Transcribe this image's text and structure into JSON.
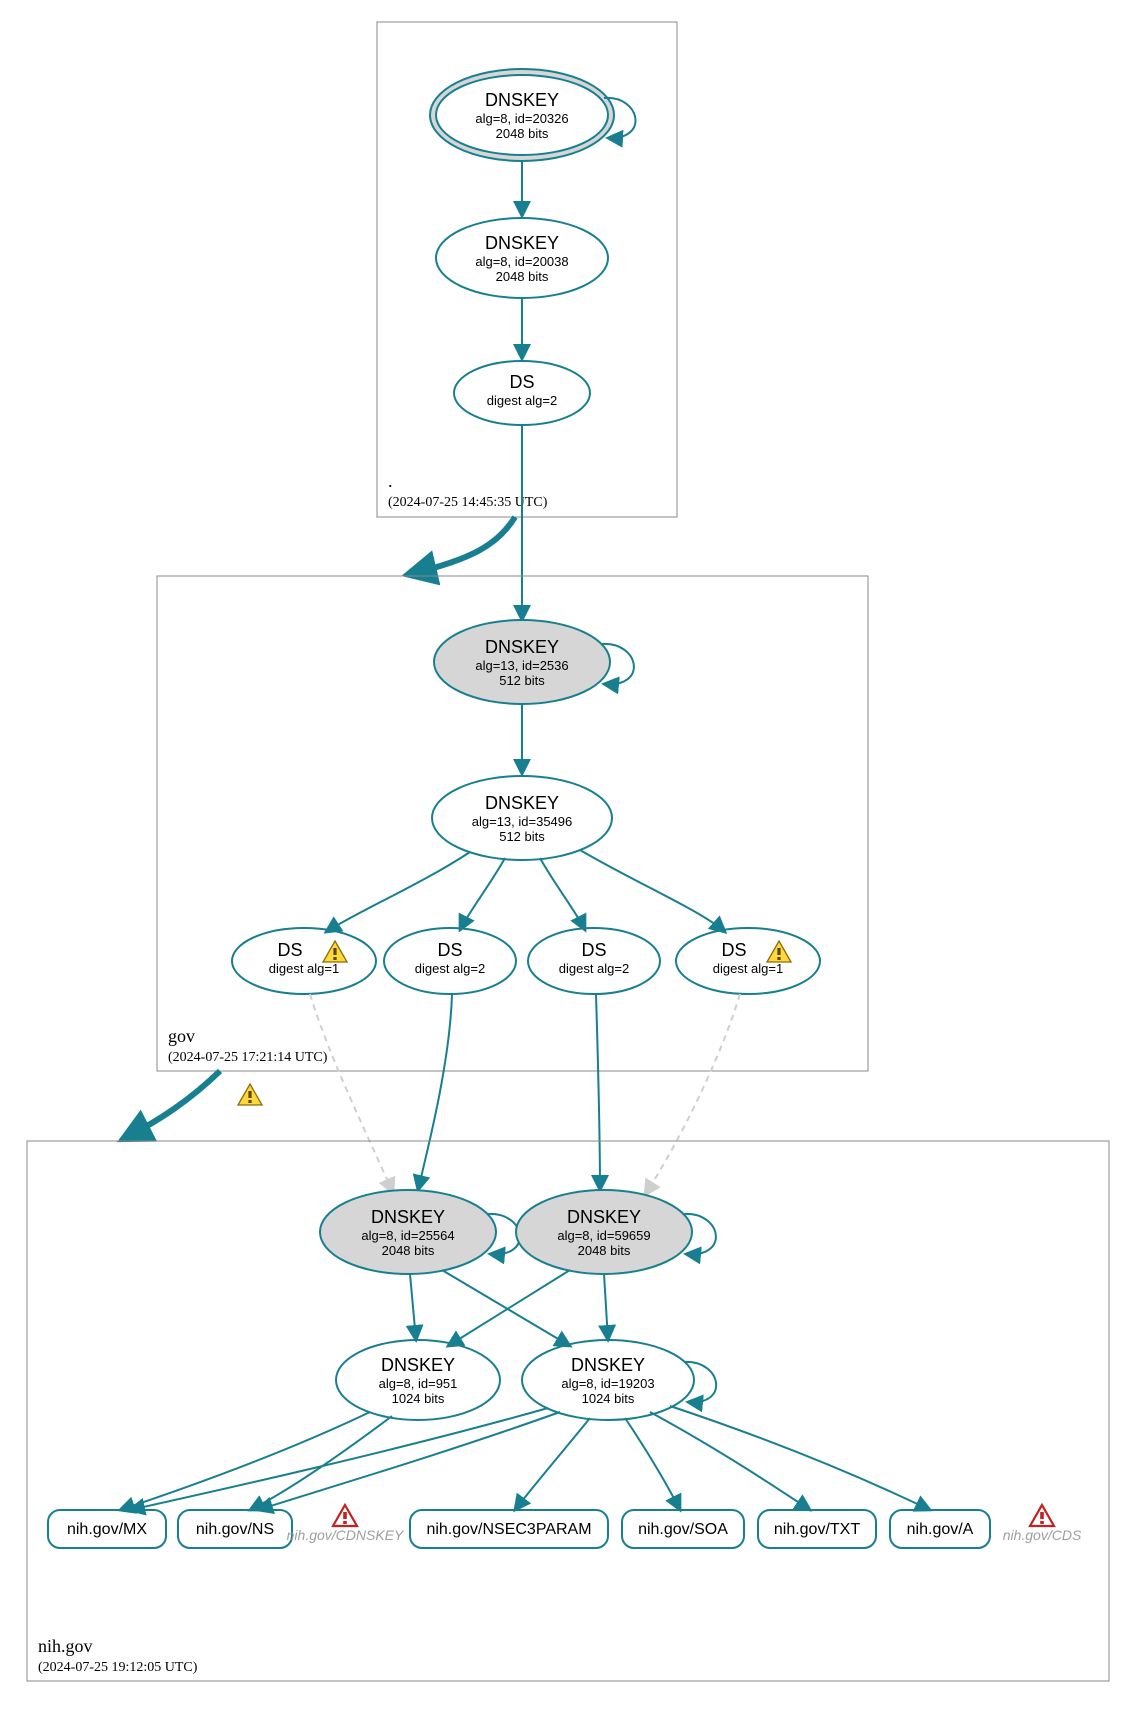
{
  "zones": {
    "root": {
      "name": ".",
      "timestamp": "(2024-07-25 14:45:35 UTC)"
    },
    "gov": {
      "name": "gov",
      "timestamp": "(2024-07-25 17:21:14 UTC)"
    },
    "nih": {
      "name": "nih.gov",
      "timestamp": "(2024-07-25 19:12:05 UTC)"
    }
  },
  "nodes": {
    "root_ksk": {
      "title": "DNSKEY",
      "line2": "alg=8, id=20326",
      "line3": "2048 bits"
    },
    "root_zsk": {
      "title": "DNSKEY",
      "line2": "alg=8, id=20038",
      "line3": "2048 bits"
    },
    "root_ds": {
      "title": "DS",
      "line2": "digest alg=2"
    },
    "gov_ksk": {
      "title": "DNSKEY",
      "line2": "alg=13, id=2536",
      "line3": "512 bits"
    },
    "gov_zsk": {
      "title": "DNSKEY",
      "line2": "alg=13, id=35496",
      "line3": "512 bits"
    },
    "gov_ds1": {
      "title": "DS",
      "line2": "digest alg=1"
    },
    "gov_ds2": {
      "title": "DS",
      "line2": "digest alg=2"
    },
    "gov_ds3": {
      "title": "DS",
      "line2": "digest alg=2"
    },
    "gov_ds4": {
      "title": "DS",
      "line2": "digest alg=1"
    },
    "nih_ksk1": {
      "title": "DNSKEY",
      "line2": "alg=8, id=25564",
      "line3": "2048 bits"
    },
    "nih_ksk2": {
      "title": "DNSKEY",
      "line2": "alg=8, id=59659",
      "line3": "2048 bits"
    },
    "nih_zsk1": {
      "title": "DNSKEY",
      "line2": "alg=8, id=951",
      "line3": "1024 bits"
    },
    "nih_zsk2": {
      "title": "DNSKEY",
      "line2": "alg=8, id=19203",
      "line3": "1024 bits"
    }
  },
  "rrsets": {
    "mx": "nih.gov/MX",
    "ns": "nih.gov/NS",
    "cdnskey": "nih.gov/CDNSKEY",
    "nsec3": "nih.gov/NSEC3PARAM",
    "soa": "nih.gov/SOA",
    "txt": "nih.gov/TXT",
    "a": "nih.gov/A",
    "cds": "nih.gov/CDS"
  },
  "icons": {
    "warning": "warning-icon",
    "error": "error-icon"
  }
}
